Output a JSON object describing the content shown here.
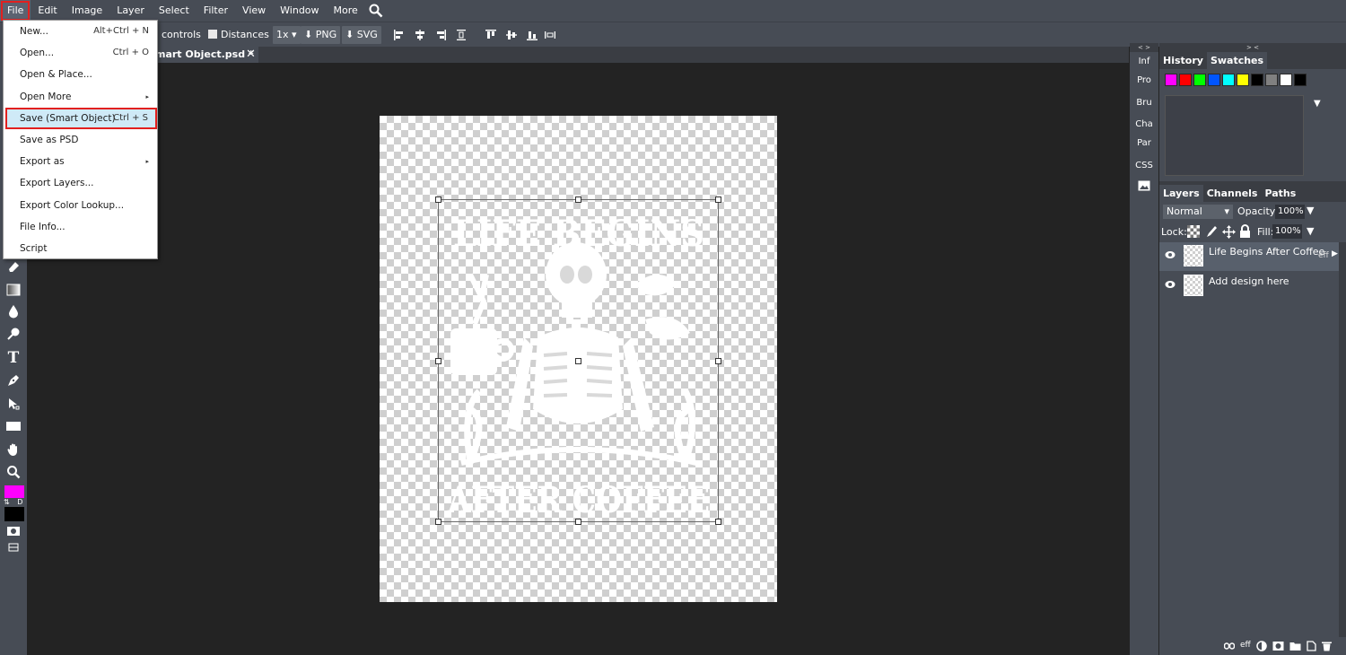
{
  "menubar": {
    "items": [
      "File",
      "Edit",
      "Image",
      "Layer",
      "Select",
      "Filter",
      "View",
      "Window",
      "More"
    ],
    "active": "File"
  },
  "options": {
    "transform_controls": "controls",
    "distances": "Distances",
    "zoom": "1x",
    "png": "PNG",
    "svg": "SVG"
  },
  "document": {
    "tab_title": "mart Object.psd *",
    "close": "✕"
  },
  "file_menu": {
    "items": [
      {
        "label": "New...",
        "shortcut": "Alt+Ctrl + N"
      },
      {
        "label": "Open...",
        "shortcut": "Ctrl + O"
      },
      {
        "label": "Open & Place...",
        "shortcut": ""
      },
      {
        "label": "Open More",
        "shortcut": "",
        "submenu": true
      },
      {
        "label": "Save (Smart Object)",
        "shortcut": "Ctrl + S",
        "highlighted": true
      },
      {
        "label": "Save as PSD",
        "shortcut": ""
      },
      {
        "label": "Export as",
        "shortcut": "",
        "submenu": true
      },
      {
        "label": "Export Layers...",
        "shortcut": ""
      },
      {
        "label": "Export Color Lookup...",
        "shortcut": ""
      },
      {
        "label": "File Info...",
        "shortcut": ""
      },
      {
        "label": "Script",
        "shortcut": ""
      }
    ]
  },
  "design": {
    "line1": "LIFE BEGINS",
    "line2": "AFTER COFFEE"
  },
  "side_tabs": [
    "Inf",
    "Pro",
    "Bru",
    "Cha",
    "Par",
    "CSS"
  ],
  "panel_collapse": {
    "left": "< >",
    "right": "> <"
  },
  "history_panel": {
    "tabs": [
      "History",
      "Swatches"
    ],
    "swatches": [
      "#ff00ff",
      "#ff0000",
      "#00ff00",
      "#0055ff",
      "#00ffff",
      "#ffff00",
      "#000000",
      "#808080",
      "#ffffff",
      "#000000"
    ]
  },
  "layers_panel": {
    "tabs": [
      "Layers",
      "Channels",
      "Paths"
    ],
    "blend_mode": "Normal",
    "opacity_label": "Opacity:",
    "opacity": "100%",
    "lock_label": "Lock:",
    "fill_label": "Fill:",
    "fill": "100%",
    "layers": [
      {
        "name": "Life Begins After Coffee",
        "effects": "eff",
        "selected": true
      },
      {
        "name": "Add design here",
        "effects": "",
        "selected": false
      }
    ],
    "footer_eff": "eff"
  },
  "colors": {
    "foreground": "#ff00ff",
    "background": "#000000",
    "highlight_border": "#e2201f"
  },
  "toolbar": {
    "swap_label": "⇅ D"
  }
}
